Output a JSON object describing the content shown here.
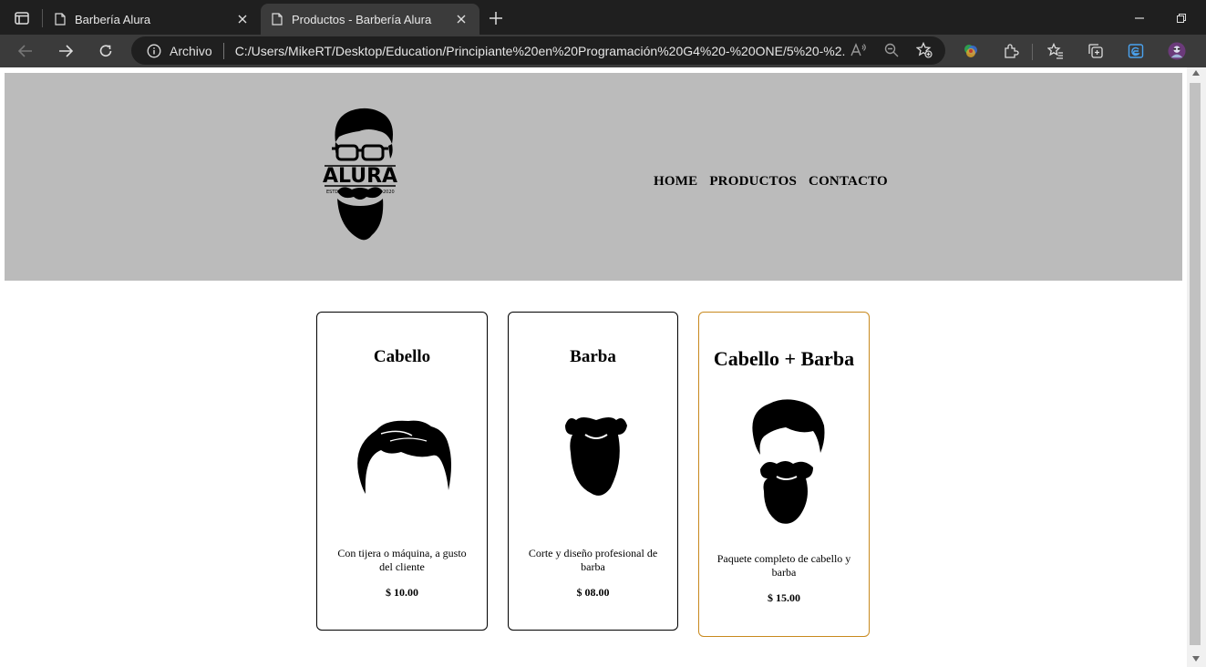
{
  "browser": {
    "tabs": [
      {
        "title": "Barbería Alura",
        "active": false
      },
      {
        "title": "Productos - Barbería Alura",
        "active": true
      }
    ],
    "address": {
      "scheme_label": "Archivo",
      "url": "C:/Users/MikeRT/Desktop/Education/Principiante%20en%20Programación%20G4%20-%20ONE/5%20-%2..."
    }
  },
  "site": {
    "logo_text": "ALURA",
    "logo_left": "ESTD",
    "logo_right": "2020",
    "nav": [
      "HOME",
      "PRODUCTOS",
      "CONTACTO"
    ]
  },
  "products": [
    {
      "title": "Cabello",
      "description": "Con tijera o máquina, a gusto del cliente",
      "price": "$ 10.00",
      "image": "hair-image"
    },
    {
      "title": "Barba",
      "description": "Corte y diseño profesional de barba",
      "price": "$ 08.00",
      "image": "beard-image"
    },
    {
      "title": "Cabello + Barba",
      "description": "Paquete completo de cabello y barba",
      "price": "$ 15.00",
      "image": "hair-and-beard-image",
      "featured": true,
      "border_color": "#c8891e"
    }
  ],
  "colors": {
    "header_bg": "#bbbbbb",
    "featured_border": "#c8891e",
    "chrome_dark": "#1f1f1f",
    "chrome_toolbar": "#3b3b3b"
  }
}
